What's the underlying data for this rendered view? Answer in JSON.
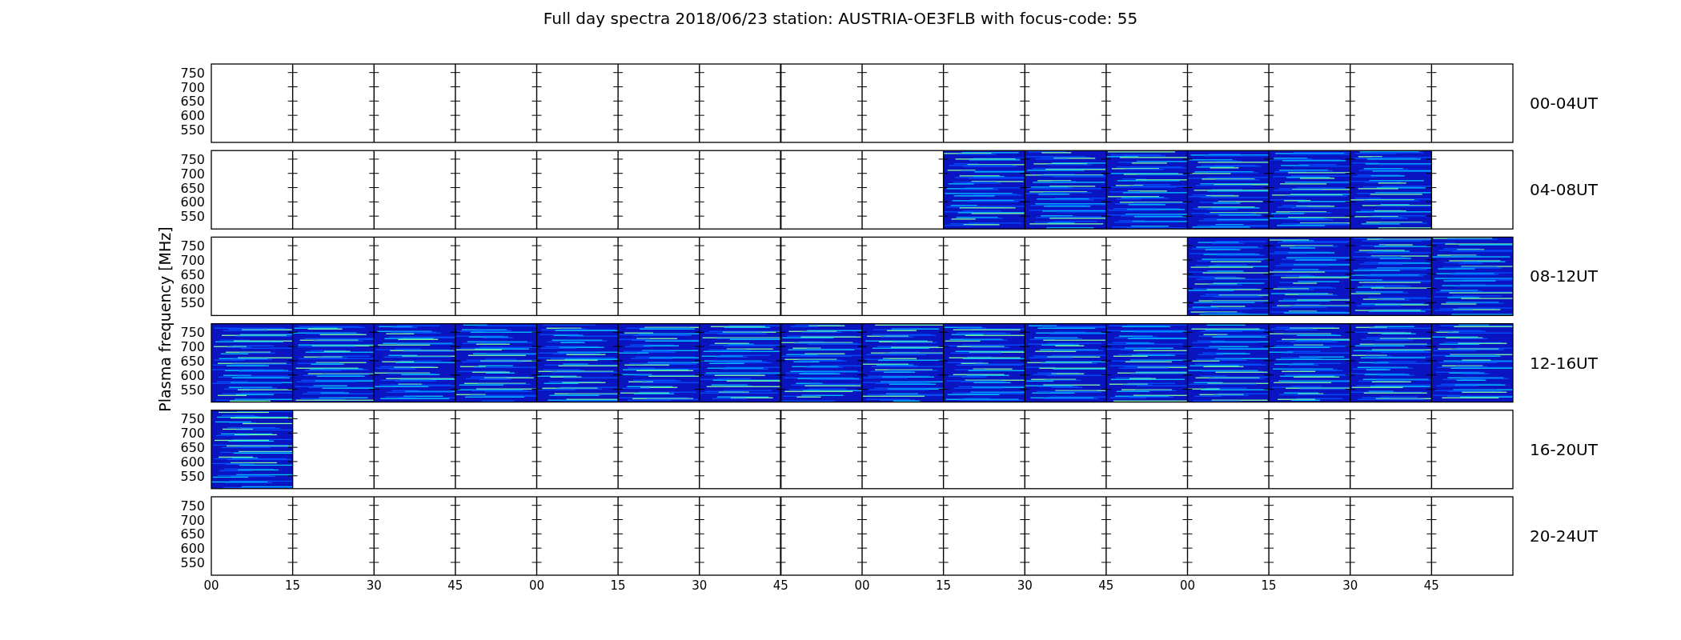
{
  "title": "Full day spectra 2018/06/23 station: AUSTRIA-OE3FLB with focus-code: 55",
  "ylabel": "Plasma frequency [MHz]",
  "rows": [
    {
      "label": "00-04UT",
      "yticks": [
        "750",
        "700",
        "650",
        "600",
        "550"
      ],
      "cells": [
        {
          "kind": "blank"
        },
        {
          "kind": "blank"
        },
        {
          "kind": "blank"
        },
        {
          "kind": "blank"
        },
        {
          "kind": "blank"
        },
        {
          "kind": "blank"
        },
        {
          "kind": "blank"
        },
        {
          "kind": "blank"
        },
        {
          "kind": "blank"
        },
        {
          "kind": "blank"
        },
        {
          "kind": "blank"
        },
        {
          "kind": "blank"
        },
        {
          "kind": "blank"
        },
        {
          "kind": "blank"
        },
        {
          "kind": "blank"
        },
        {
          "kind": "blank"
        }
      ]
    },
    {
      "label": "04-08UT",
      "yticks": [
        "750",
        "700",
        "650",
        "600",
        "550"
      ],
      "cells": [
        {
          "kind": "blank"
        },
        {
          "kind": "blank"
        },
        {
          "kind": "blank"
        },
        {
          "kind": "blank"
        },
        {
          "kind": "blank"
        },
        {
          "kind": "blank"
        },
        {
          "kind": "blank"
        },
        {
          "kind": "blank"
        },
        {
          "kind": "blank"
        },
        {
          "kind": "spectrum"
        },
        {
          "kind": "spectrum"
        },
        {
          "kind": "spectrum"
        },
        {
          "kind": "spectrum"
        },
        {
          "kind": "spectrum"
        },
        {
          "kind": "spectrum"
        },
        {
          "kind": "blank"
        }
      ]
    },
    {
      "label": "08-12UT",
      "yticks": [
        "750",
        "700",
        "650",
        "600",
        "550"
      ],
      "cells": [
        {
          "kind": "blank"
        },
        {
          "kind": "blank"
        },
        {
          "kind": "blank"
        },
        {
          "kind": "blank"
        },
        {
          "kind": "blank"
        },
        {
          "kind": "blank"
        },
        {
          "kind": "blank"
        },
        {
          "kind": "blank"
        },
        {
          "kind": "blank"
        },
        {
          "kind": "blank"
        },
        {
          "kind": "blank"
        },
        {
          "kind": "blank"
        },
        {
          "kind": "spectrum"
        },
        {
          "kind": "spectrum"
        },
        {
          "kind": "spectrum"
        },
        {
          "kind": "spectrum"
        }
      ]
    },
    {
      "label": "12-16UT",
      "yticks": [
        "750",
        "700",
        "650",
        "600",
        "550"
      ],
      "cells": [
        {
          "kind": "spectrum"
        },
        {
          "kind": "spectrum"
        },
        {
          "kind": "spectrum"
        },
        {
          "kind": "spectrum"
        },
        {
          "kind": "spectrum"
        },
        {
          "kind": "spectrum"
        },
        {
          "kind": "spectrum"
        },
        {
          "kind": "spectrum"
        },
        {
          "kind": "spectrum"
        },
        {
          "kind": "spectrum"
        },
        {
          "kind": "spectrum"
        },
        {
          "kind": "spectrum"
        },
        {
          "kind": "spectrum"
        },
        {
          "kind": "spectrum"
        },
        {
          "kind": "spectrum"
        },
        {
          "kind": "spectrum"
        }
      ]
    },
    {
      "label": "16-20UT",
      "yticks": [
        "750",
        "700",
        "650",
        "600",
        "550"
      ],
      "cells": [
        {
          "kind": "spectrum"
        },
        {
          "kind": "blank"
        },
        {
          "kind": "blank"
        },
        {
          "kind": "blank"
        },
        {
          "kind": "blank"
        },
        {
          "kind": "blank"
        },
        {
          "kind": "blank"
        },
        {
          "kind": "blank"
        },
        {
          "kind": "blank"
        },
        {
          "kind": "blank"
        },
        {
          "kind": "blank"
        },
        {
          "kind": "blank"
        },
        {
          "kind": "blank"
        },
        {
          "kind": "blank"
        },
        {
          "kind": "blank"
        },
        {
          "kind": "blank"
        }
      ]
    },
    {
      "label": "20-24UT",
      "yticks": [
        "750",
        "700",
        "650",
        "600",
        "550"
      ],
      "cells": [
        {
          "kind": "blank"
        },
        {
          "kind": "blank"
        },
        {
          "kind": "blank"
        },
        {
          "kind": "blank"
        },
        {
          "kind": "blank"
        },
        {
          "kind": "blank"
        },
        {
          "kind": "blank"
        },
        {
          "kind": "blank"
        },
        {
          "kind": "blank"
        },
        {
          "kind": "blank"
        },
        {
          "kind": "blank"
        },
        {
          "kind": "blank"
        },
        {
          "kind": "blank"
        },
        {
          "kind": "blank"
        },
        {
          "kind": "blank"
        },
        {
          "kind": "blank"
        }
      ]
    }
  ],
  "xticks": [
    "00",
    "15",
    "30",
    "45",
    "00",
    "15",
    "30",
    "45",
    "00",
    "15",
    "30",
    "45",
    "00",
    "15",
    "30",
    "45"
  ]
}
